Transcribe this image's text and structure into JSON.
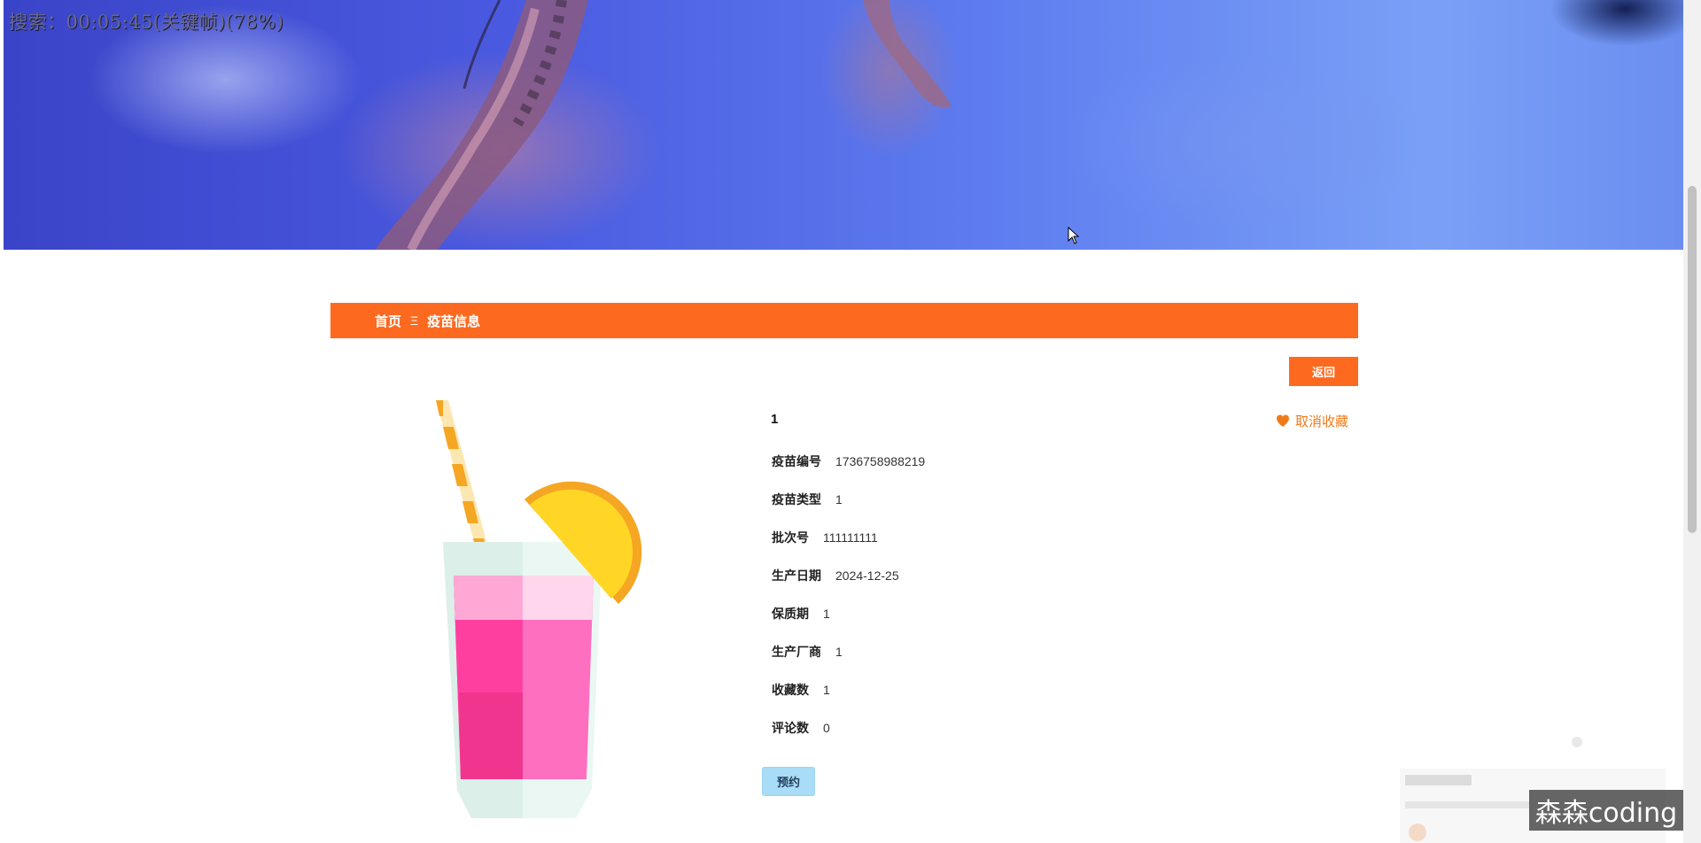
{
  "overlay": {
    "text": "搜索：00:05:45(关键帧)(78%)"
  },
  "breadcrumb": {
    "home": "首页",
    "separator": "Ξ",
    "current": "疫苗信息"
  },
  "actions": {
    "back_label": "返回",
    "favorite_label": "取消收藏",
    "book_label": "预约"
  },
  "product": {
    "title": "1",
    "fields": [
      {
        "label": "疫苗编号",
        "value": "1736758988219"
      },
      {
        "label": "疫苗类型",
        "value": "1"
      },
      {
        "label": "批次号",
        "value": "111111111"
      },
      {
        "label": "生产日期",
        "value": "2024-12-25"
      },
      {
        "label": "保质期",
        "value": "1"
      },
      {
        "label": "生产厂商",
        "value": "1"
      },
      {
        "label": "收藏数",
        "value": "1"
      },
      {
        "label": "评论数",
        "value": "0"
      }
    ]
  },
  "watermark": "森森coding",
  "colors": {
    "accent": "#fd6a1f",
    "favorite": "#f07a1a",
    "book_button": "#a9dcf7"
  },
  "icons": {
    "favorite": "heart-icon",
    "cursor": "mouse-pointer-icon"
  }
}
